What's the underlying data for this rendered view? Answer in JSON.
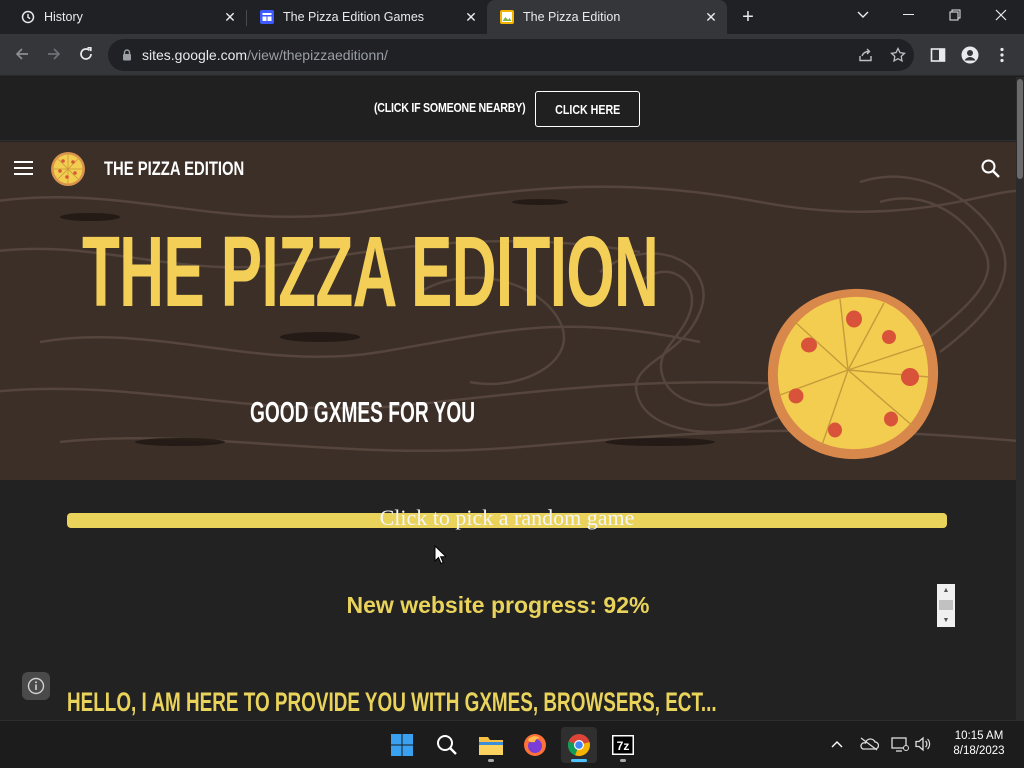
{
  "browser": {
    "tabs": [
      {
        "label": "History",
        "icon": "history-icon",
        "active": false
      },
      {
        "label": "The Pizza Edition Games",
        "icon": "site-favicon",
        "active": false
      },
      {
        "label": "The Pizza Edition",
        "icon": "google-sites-favicon",
        "active": true
      }
    ],
    "address": {
      "host": "sites.google.com",
      "path": "/view/thepizzaeditionn/"
    }
  },
  "site": {
    "announcement": {
      "text": "(Click if someone nearby)",
      "button_label": "Click here"
    },
    "nav_title": "The Pizza Edition",
    "hero_title": "The Pizza Edition",
    "hero_subtitle": "Good gxmes for you",
    "random_game_label": "Click to pick a random game",
    "progress_text": "New website progress: 92%",
    "intro_heading": "Hello, I am here to provide you with gxmes, browsers, ect..."
  },
  "colors": {
    "accent_yellow": "#e9d35b",
    "hero_title": "#f3cf58",
    "bg": "#222222"
  },
  "taskbar": {
    "apps": [
      "windows-start-icon",
      "search-icon",
      "file-explorer-icon",
      "firefox-icon",
      "chrome-icon",
      "7zip-icon"
    ],
    "time": "10:15 AM",
    "date": "8/18/2023"
  }
}
